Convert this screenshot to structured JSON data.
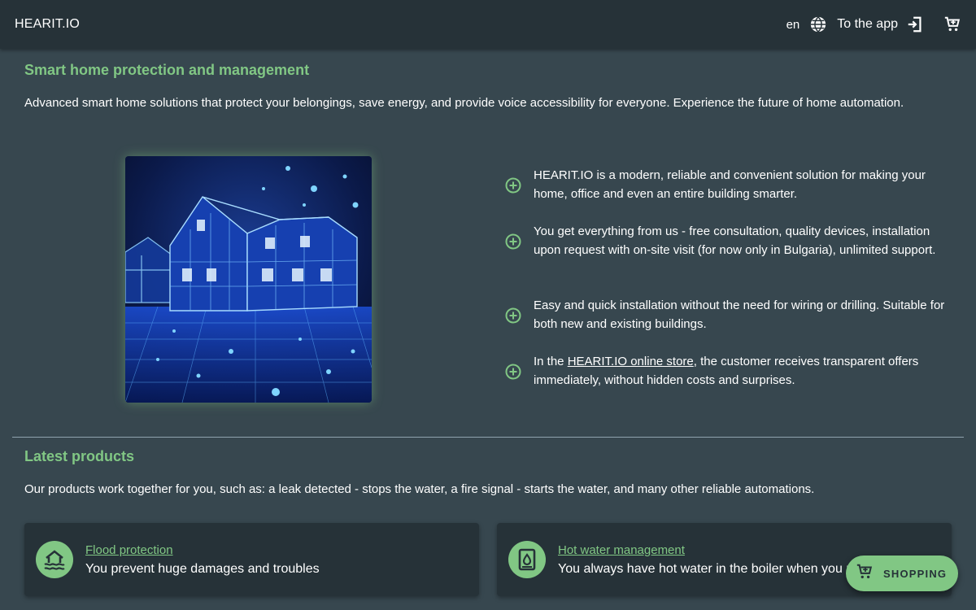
{
  "header": {
    "brand": "HEARIT.IO",
    "language": "en",
    "to_app_label": "To the app"
  },
  "intro": {
    "title": "Smart home protection and management",
    "description": "Advanced smart home solutions that protect your belongings, save energy, and provide voice accessibility for everyone. Experience the future of home automation."
  },
  "features": [
    {
      "text": "HEARIT.IO is a modern, reliable and convenient solution for making your home, office and even an entire building smarter."
    },
    {
      "text": "You get everything from us - free consultation, quality devices, installation upon request with on-site visit (for now only in Bulgaria), unlimited support."
    },
    {
      "text": "Easy and quick installation without the need for wiring or drilling. Suitable for both new and existing buildings."
    },
    {
      "prefix": "In the ",
      "link": "HEARIT.IO online store",
      "suffix": ", the customer receives transparent offers immediately, without hidden costs and surprises."
    }
  ],
  "products": {
    "title": "Latest products",
    "description": "Our products work together for you, such as: a leak detected - stops the water, a fire signal - starts the water, and many other reliable automations.",
    "items": [
      {
        "title": "Flood protection",
        "description": "You prevent huge damages and troubles",
        "icon": "flood-house-icon"
      },
      {
        "title": "Hot water management",
        "description": "You always have hot water in the boiler when you need it",
        "icon": "water-boiler-icon"
      }
    ]
  },
  "shopping_button": {
    "label": "SHOPPING"
  },
  "colors": {
    "accent": "#81c784",
    "background": "#37474f",
    "surface": "#263238",
    "text": "#ffffff"
  }
}
